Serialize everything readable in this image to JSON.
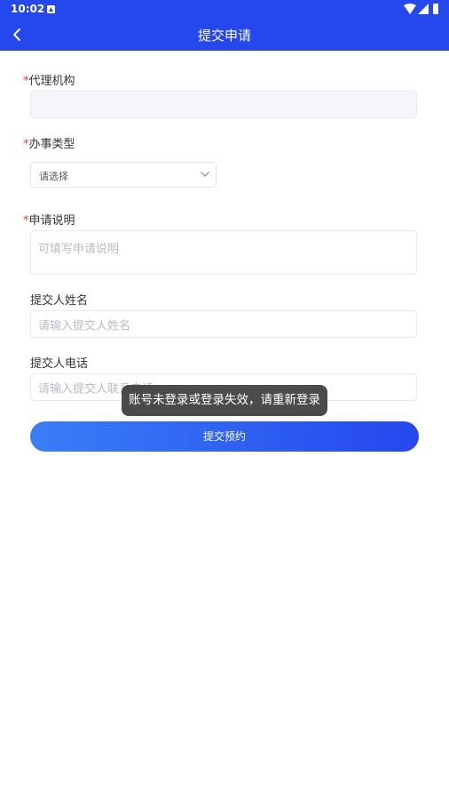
{
  "status_bar": {
    "time": "10:02"
  },
  "header": {
    "title": "提交申请"
  },
  "form": {
    "agency": {
      "required_mark": "*",
      "label": "代理机构",
      "value": ""
    },
    "business_type": {
      "required_mark": "*",
      "label": "办事类型",
      "selected": "请选择"
    },
    "description": {
      "required_mark": "*",
      "label": "申请说明",
      "placeholder": "可填写申请说明"
    },
    "submitter_name": {
      "label": "提交人姓名",
      "placeholder": "请输入提交人姓名"
    },
    "submitter_phone": {
      "label": "提交人电话",
      "placeholder": "请输入提交人联系电话"
    },
    "submit_label": "提交预约"
  },
  "toast": {
    "message": "账号未登录或登录失效，请重新登录"
  },
  "colors": {
    "header_bg": "#2547ee",
    "required": "#ee3333",
    "button_start": "#3a7ef7",
    "button_end": "#2547ee"
  }
}
